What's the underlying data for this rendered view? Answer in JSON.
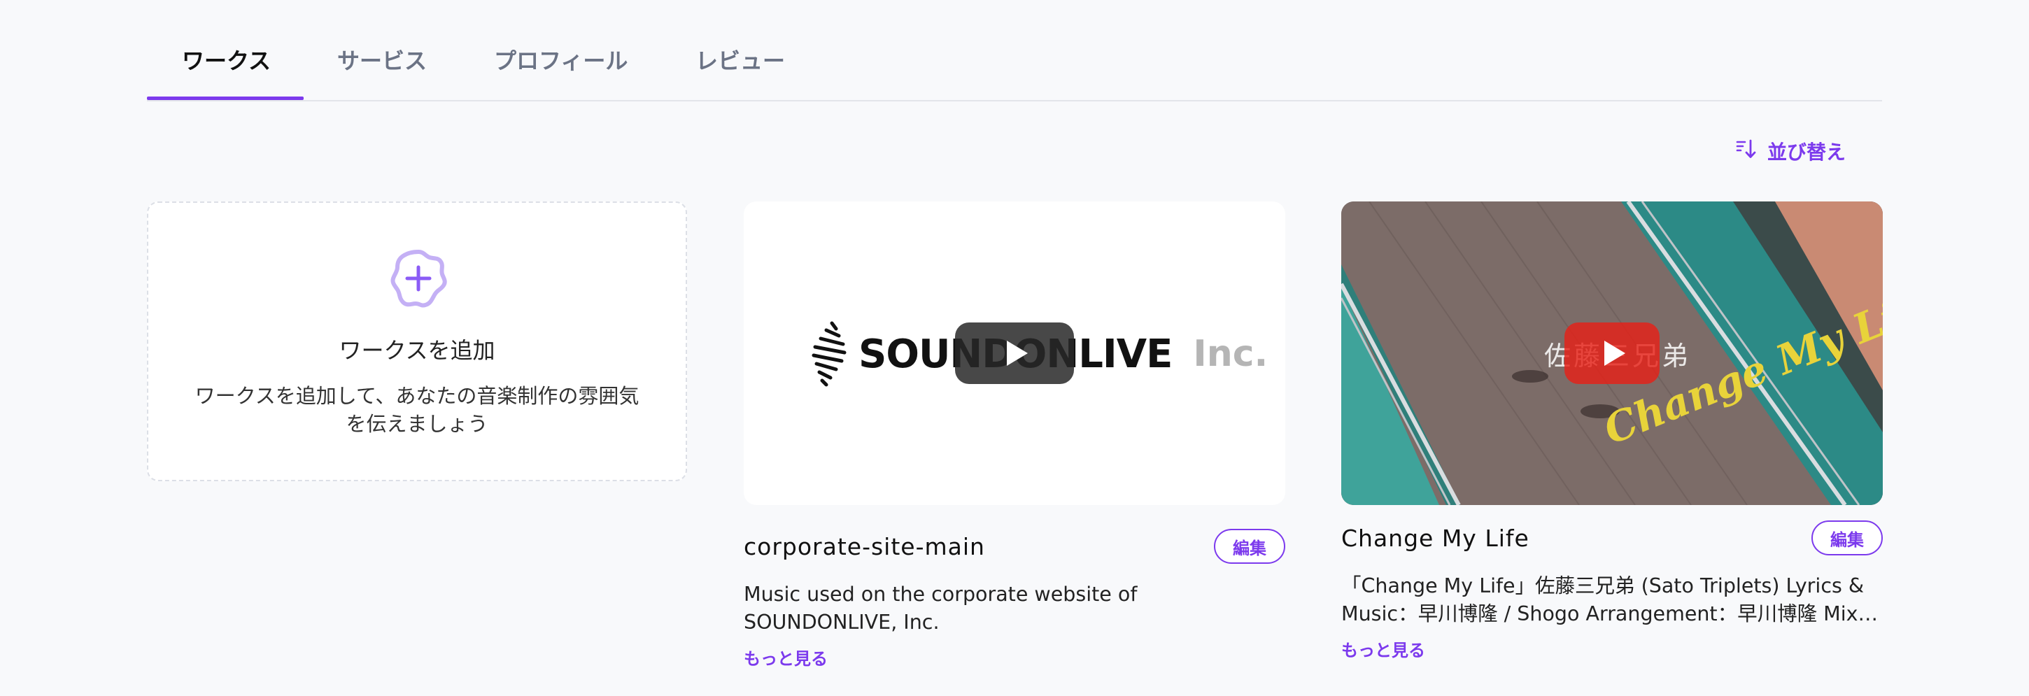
{
  "tabs": [
    {
      "label": "ワークス",
      "active": true
    },
    {
      "label": "サービス",
      "active": false
    },
    {
      "label": "プロフィール",
      "active": false
    },
    {
      "label": "レビュー",
      "active": false
    }
  ],
  "sort": {
    "label": "並び替え",
    "icon": "sort-icon"
  },
  "add_card": {
    "title": "ワークスを追加",
    "description": "ワークスを追加して、あなたの音楽制作の雰囲気を伝えましょう",
    "icon": "add-circle-icon"
  },
  "works": [
    {
      "title": "corporate-site-main",
      "description": "Music used on the corporate website of SOUNDONLIVE, Inc.",
      "more_label": "もっと見る",
      "edit_label": "編集",
      "thumbnail": {
        "logo_text": "SOUNDONLIVE",
        "logo_suffix": "Inc."
      }
    },
    {
      "title": "Change My Life",
      "description": "「Change My Life」佐藤三兄弟 (Sato Triplets) Lyrics & Music：早川博隆 / Shogo Arrangement：早川博隆 Mix & Mastering：早川博隆",
      "more_label": "もっと見る",
      "edit_label": "編集",
      "thumbnail": {
        "overlay_text": "佐藤三兄弟",
        "script_text": "Change My Life"
      }
    }
  ],
  "colors": {
    "accent": "#7c3aed",
    "accent_light": "#c4b0f5",
    "background": "#f8f9fb",
    "logo_red": "#e43b3b"
  }
}
